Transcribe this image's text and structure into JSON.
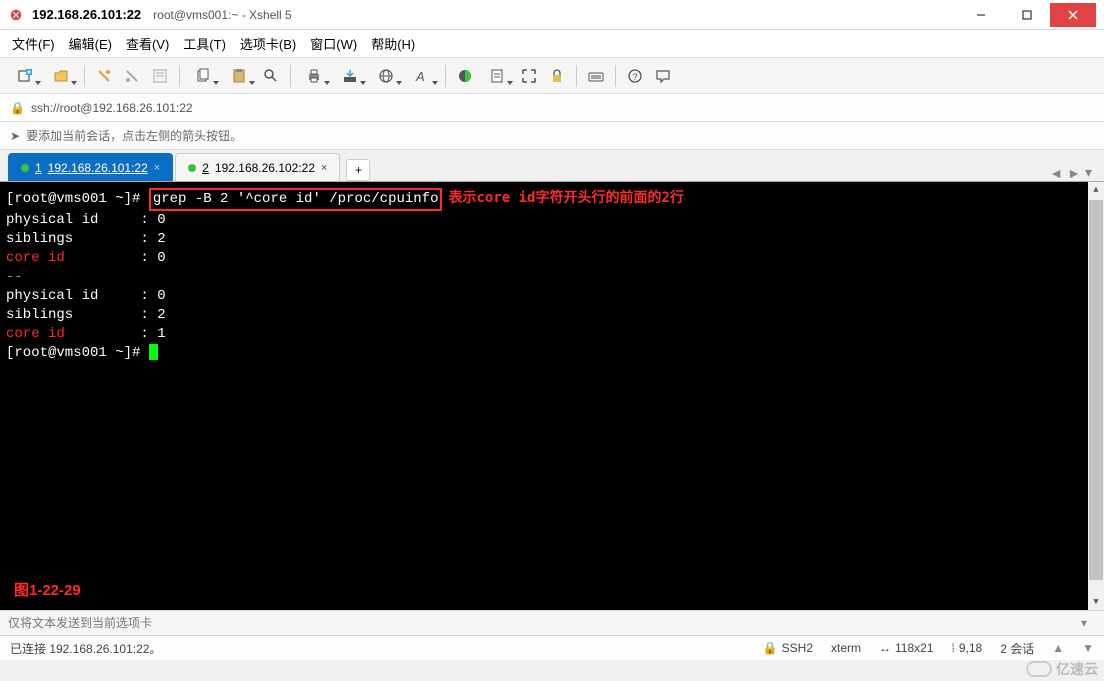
{
  "title_bar": {
    "ip": "192.168.26.101:22",
    "subtitle": "root@vms001:~ - Xshell 5"
  },
  "menu": {
    "file": "文件(F)",
    "edit": "编辑(E)",
    "view": "查看(V)",
    "tools": "工具(T)",
    "tabs": "选项卡(B)",
    "window": "窗口(W)",
    "help": "帮助(H)"
  },
  "address_bar": {
    "url": "ssh://root@192.168.26.101:22"
  },
  "info_bar": {
    "text": "要添加当前会话，点击左侧的箭头按钮。"
  },
  "tabs": {
    "items": [
      {
        "num": "1",
        "label": "192.168.26.101:22",
        "active": true
      },
      {
        "num": "2",
        "label": "192.168.26.102:22",
        "active": false
      }
    ],
    "add": "+"
  },
  "terminal": {
    "prompt1": "[root@vms001 ~]# ",
    "command": "grep -B 2 '^core id' /proc/cpuinfo",
    "annotation": "表示core id字符开头行的前面的2行",
    "lines": [
      {
        "type": "kv",
        "key": "physical id",
        "val": "0"
      },
      {
        "type": "kv",
        "key": "siblings",
        "val": "2"
      },
      {
        "type": "core",
        "key": "core id",
        "val": "0"
      },
      {
        "type": "sep",
        "text": "--"
      },
      {
        "type": "kv",
        "key": "physical id",
        "val": "0"
      },
      {
        "type": "kv",
        "key": "siblings",
        "val": "2"
      },
      {
        "type": "core",
        "key": "core id",
        "val": "1"
      }
    ],
    "prompt2": "[root@vms001 ~]# ",
    "figure_label": "图1-22-29"
  },
  "send_bar": {
    "placeholder": "仅将文本发送到当前选项卡"
  },
  "status_bar": {
    "connected": "已连接 192.168.26.101:22。",
    "protocol": "SSH2",
    "term_type": "xterm",
    "size": "118x21",
    "cursor_pos": "9,18",
    "sessions": "2 会话"
  },
  "watermark": "亿速云"
}
